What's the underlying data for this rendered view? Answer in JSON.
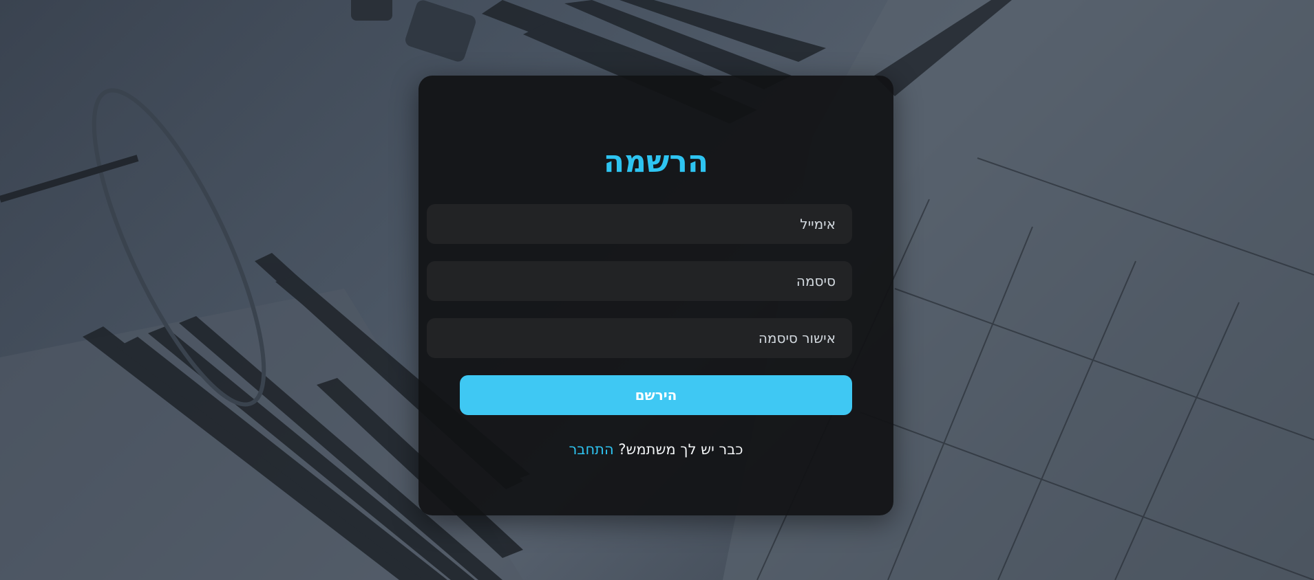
{
  "page": {
    "background_color": "#4a5563",
    "accent_color": "#2ec4f1"
  },
  "form": {
    "title": "הרשמה",
    "email_placeholder": "אימייל",
    "password_placeholder": "סיסמה",
    "confirm_password_placeholder": "אישור סיסמה",
    "submit_label": "הירשם",
    "have_account_text": "כבר יש לך משתמש?",
    "login_link_label": "התחבר"
  }
}
